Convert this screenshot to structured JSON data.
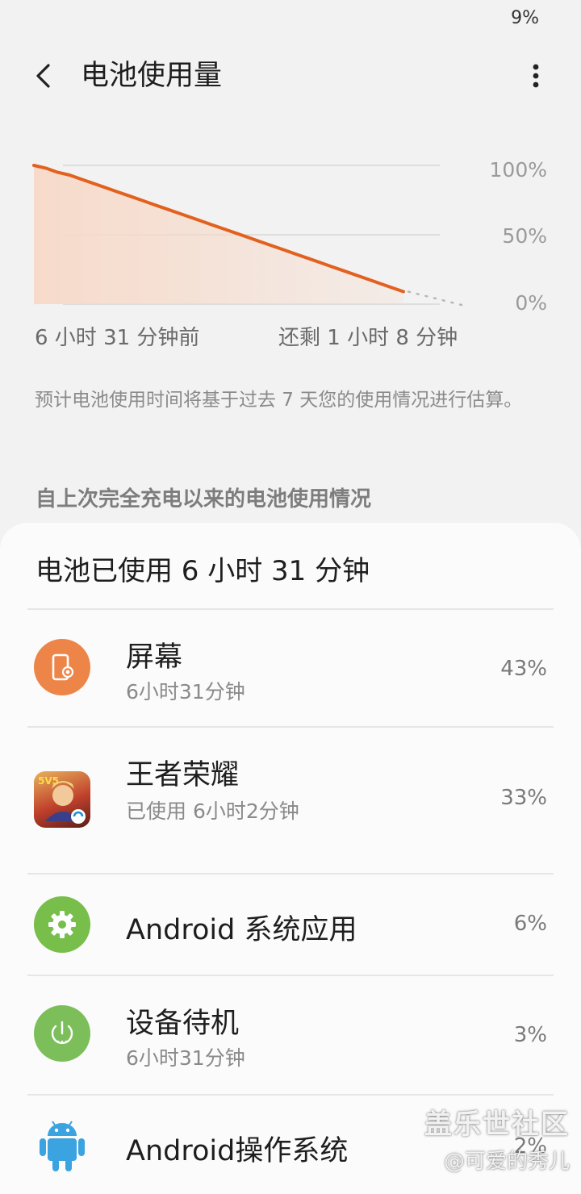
{
  "status_bar": {
    "battery": "9%"
  },
  "header": {
    "title": "电池使用量"
  },
  "chart_data": {
    "type": "line",
    "x_labels": [
      "6 小时 31 分钟前",
      "还剩 1 小时 8 分钟"
    ],
    "y_ticks": [
      "100%",
      "50%",
      "0%"
    ],
    "ylim": [
      0,
      100
    ],
    "series": [
      {
        "values": [
          100,
          98,
          95,
          93,
          90,
          87,
          84,
          81,
          78,
          75,
          72,
          69,
          66,
          63,
          60,
          57,
          54,
          51,
          48,
          45,
          42,
          39,
          36,
          33,
          30,
          27,
          24,
          21,
          18,
          15,
          12,
          9
        ]
      }
    ],
    "projection": {
      "from": 9,
      "to": 0
    },
    "colors": {
      "line": "#e2611f",
      "fill": "#f7d9c8",
      "grid": "#d8d8d8",
      "projection": "#b8b8b8"
    }
  },
  "note": "预计电池使用时间将基于过去 7 天您的使用情况进行估算。",
  "section": {
    "header": "自上次完全充电以来的电池使用情况"
  },
  "card": {
    "title": "电池已使用 6 小时 31 分钟",
    "items": [
      {
        "name": "屏幕",
        "sub": "6小时31分钟",
        "pct": "43%",
        "icon": "screen-brightness-icon",
        "color": "#ee8548"
      },
      {
        "name": "王者荣耀",
        "sub": "已使用 6小时2分钟",
        "pct": "33%",
        "icon": "game-app-icon",
        "color": "#b23a2a"
      },
      {
        "name": "Android 系统应用",
        "sub": "",
        "pct": "6%",
        "icon": "gear-icon",
        "color": "#78be4a"
      },
      {
        "name": "设备待机",
        "sub": "6小时31分钟",
        "pct": "3%",
        "icon": "power-standby-icon",
        "color": "#7cbf5a"
      },
      {
        "name": "Android操作系统",
        "sub": "",
        "pct": "2%",
        "icon": "android-robot-icon",
        "color": "#3aa3e0"
      }
    ]
  },
  "watermark": {
    "line1": "盖乐世社区",
    "line2": "@可爱的秀儿"
  }
}
